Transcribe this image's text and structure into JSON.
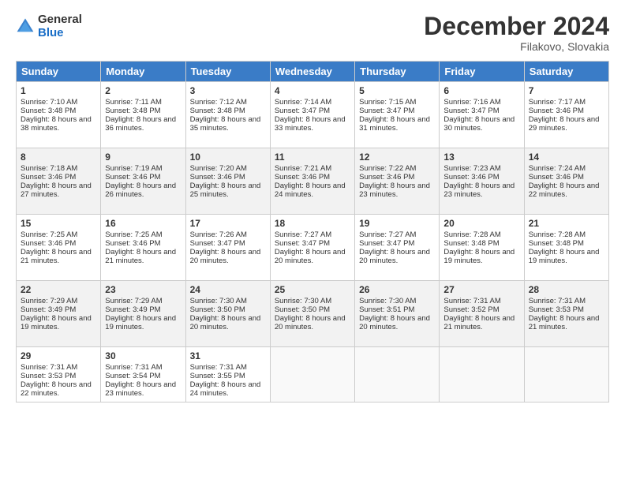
{
  "logo": {
    "general": "General",
    "blue": "Blue"
  },
  "title": "December 2024",
  "location": "Filakovo, Slovakia",
  "days_header": [
    "Sunday",
    "Monday",
    "Tuesday",
    "Wednesday",
    "Thursday",
    "Friday",
    "Saturday"
  ],
  "weeks": [
    [
      {
        "day": "1",
        "sunrise": "7:10 AM",
        "sunset": "3:48 PM",
        "daylight": "8 hours and 38 minutes."
      },
      {
        "day": "2",
        "sunrise": "7:11 AM",
        "sunset": "3:48 PM",
        "daylight": "8 hours and 36 minutes."
      },
      {
        "day": "3",
        "sunrise": "7:12 AM",
        "sunset": "3:48 PM",
        "daylight": "8 hours and 35 minutes."
      },
      {
        "day": "4",
        "sunrise": "7:14 AM",
        "sunset": "3:47 PM",
        "daylight": "8 hours and 33 minutes."
      },
      {
        "day": "5",
        "sunrise": "7:15 AM",
        "sunset": "3:47 PM",
        "daylight": "8 hours and 31 minutes."
      },
      {
        "day": "6",
        "sunrise": "7:16 AM",
        "sunset": "3:47 PM",
        "daylight": "8 hours and 30 minutes."
      },
      {
        "day": "7",
        "sunrise": "7:17 AM",
        "sunset": "3:46 PM",
        "daylight": "8 hours and 29 minutes."
      }
    ],
    [
      {
        "day": "8",
        "sunrise": "7:18 AM",
        "sunset": "3:46 PM",
        "daylight": "8 hours and 27 minutes."
      },
      {
        "day": "9",
        "sunrise": "7:19 AM",
        "sunset": "3:46 PM",
        "daylight": "8 hours and 26 minutes."
      },
      {
        "day": "10",
        "sunrise": "7:20 AM",
        "sunset": "3:46 PM",
        "daylight": "8 hours and 25 minutes."
      },
      {
        "day": "11",
        "sunrise": "7:21 AM",
        "sunset": "3:46 PM",
        "daylight": "8 hours and 24 minutes."
      },
      {
        "day": "12",
        "sunrise": "7:22 AM",
        "sunset": "3:46 PM",
        "daylight": "8 hours and 23 minutes."
      },
      {
        "day": "13",
        "sunrise": "7:23 AM",
        "sunset": "3:46 PM",
        "daylight": "8 hours and 23 minutes."
      },
      {
        "day": "14",
        "sunrise": "7:24 AM",
        "sunset": "3:46 PM",
        "daylight": "8 hours and 22 minutes."
      }
    ],
    [
      {
        "day": "15",
        "sunrise": "7:25 AM",
        "sunset": "3:46 PM",
        "daylight": "8 hours and 21 minutes."
      },
      {
        "day": "16",
        "sunrise": "7:25 AM",
        "sunset": "3:46 PM",
        "daylight": "8 hours and 21 minutes."
      },
      {
        "day": "17",
        "sunrise": "7:26 AM",
        "sunset": "3:47 PM",
        "daylight": "8 hours and 20 minutes."
      },
      {
        "day": "18",
        "sunrise": "7:27 AM",
        "sunset": "3:47 PM",
        "daylight": "8 hours and 20 minutes."
      },
      {
        "day": "19",
        "sunrise": "7:27 AM",
        "sunset": "3:47 PM",
        "daylight": "8 hours and 20 minutes."
      },
      {
        "day": "20",
        "sunrise": "7:28 AM",
        "sunset": "3:48 PM",
        "daylight": "8 hours and 19 minutes."
      },
      {
        "day": "21",
        "sunrise": "7:28 AM",
        "sunset": "3:48 PM",
        "daylight": "8 hours and 19 minutes."
      }
    ],
    [
      {
        "day": "22",
        "sunrise": "7:29 AM",
        "sunset": "3:49 PM",
        "daylight": "8 hours and 19 minutes."
      },
      {
        "day": "23",
        "sunrise": "7:29 AM",
        "sunset": "3:49 PM",
        "daylight": "8 hours and 19 minutes."
      },
      {
        "day": "24",
        "sunrise": "7:30 AM",
        "sunset": "3:50 PM",
        "daylight": "8 hours and 20 minutes."
      },
      {
        "day": "25",
        "sunrise": "7:30 AM",
        "sunset": "3:50 PM",
        "daylight": "8 hours and 20 minutes."
      },
      {
        "day": "26",
        "sunrise": "7:30 AM",
        "sunset": "3:51 PM",
        "daylight": "8 hours and 20 minutes."
      },
      {
        "day": "27",
        "sunrise": "7:31 AM",
        "sunset": "3:52 PM",
        "daylight": "8 hours and 21 minutes."
      },
      {
        "day": "28",
        "sunrise": "7:31 AM",
        "sunset": "3:53 PM",
        "daylight": "8 hours and 21 minutes."
      }
    ],
    [
      {
        "day": "29",
        "sunrise": "7:31 AM",
        "sunset": "3:53 PM",
        "daylight": "8 hours and 22 minutes."
      },
      {
        "day": "30",
        "sunrise": "7:31 AM",
        "sunset": "3:54 PM",
        "daylight": "8 hours and 23 minutes."
      },
      {
        "day": "31",
        "sunrise": "7:31 AM",
        "sunset": "3:55 PM",
        "daylight": "8 hours and 24 minutes."
      },
      null,
      null,
      null,
      null
    ]
  ],
  "labels": {
    "sunrise": "Sunrise:",
    "sunset": "Sunset:",
    "daylight": "Daylight:"
  }
}
